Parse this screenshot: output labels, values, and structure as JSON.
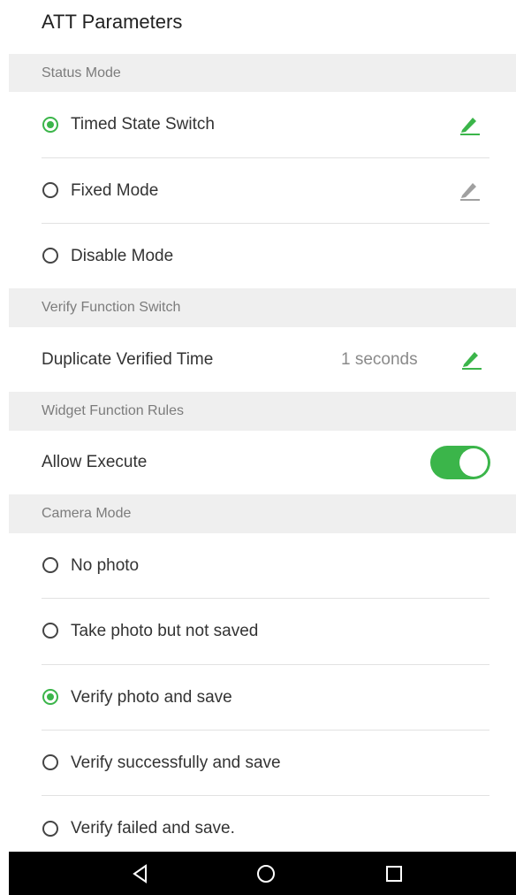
{
  "header": {
    "title": "ATT Parameters"
  },
  "sections": {
    "status_mode": "Status Mode",
    "verify_function_switch": "Verify Function Switch",
    "widget_function_rules": "Widget Function Rules",
    "camera_mode": "Camera Mode"
  },
  "status_mode": {
    "options": [
      {
        "label": "Timed State Switch",
        "selected": true,
        "editable": true,
        "edit_icon_color": "#3bb54a"
      },
      {
        "label": "Fixed Mode",
        "selected": false,
        "editable": true,
        "edit_icon_color": "#9a9a9a"
      },
      {
        "label": "Disable Mode",
        "selected": false,
        "editable": false
      }
    ]
  },
  "verify_function": {
    "duplicate_label": "Duplicate Verified Time",
    "duplicate_value": "1 seconds"
  },
  "widget_rules": {
    "allow_execute_label": "Allow Execute",
    "allow_execute_on": true
  },
  "camera_mode": {
    "options": [
      {
        "label": "No photo",
        "selected": false
      },
      {
        "label": "Take photo but not saved",
        "selected": false
      },
      {
        "label": "Verify photo and save",
        "selected": true
      },
      {
        "label": "Verify successfully and save",
        "selected": false
      },
      {
        "label": "Verify failed and save.",
        "selected": false
      }
    ]
  },
  "colors": {
    "accent": "#3bb54a",
    "section_bg": "#efefef",
    "navbar_bg": "#000000"
  },
  "navbar": {
    "icons": [
      "back-icon",
      "home-icon",
      "recents-icon"
    ]
  }
}
